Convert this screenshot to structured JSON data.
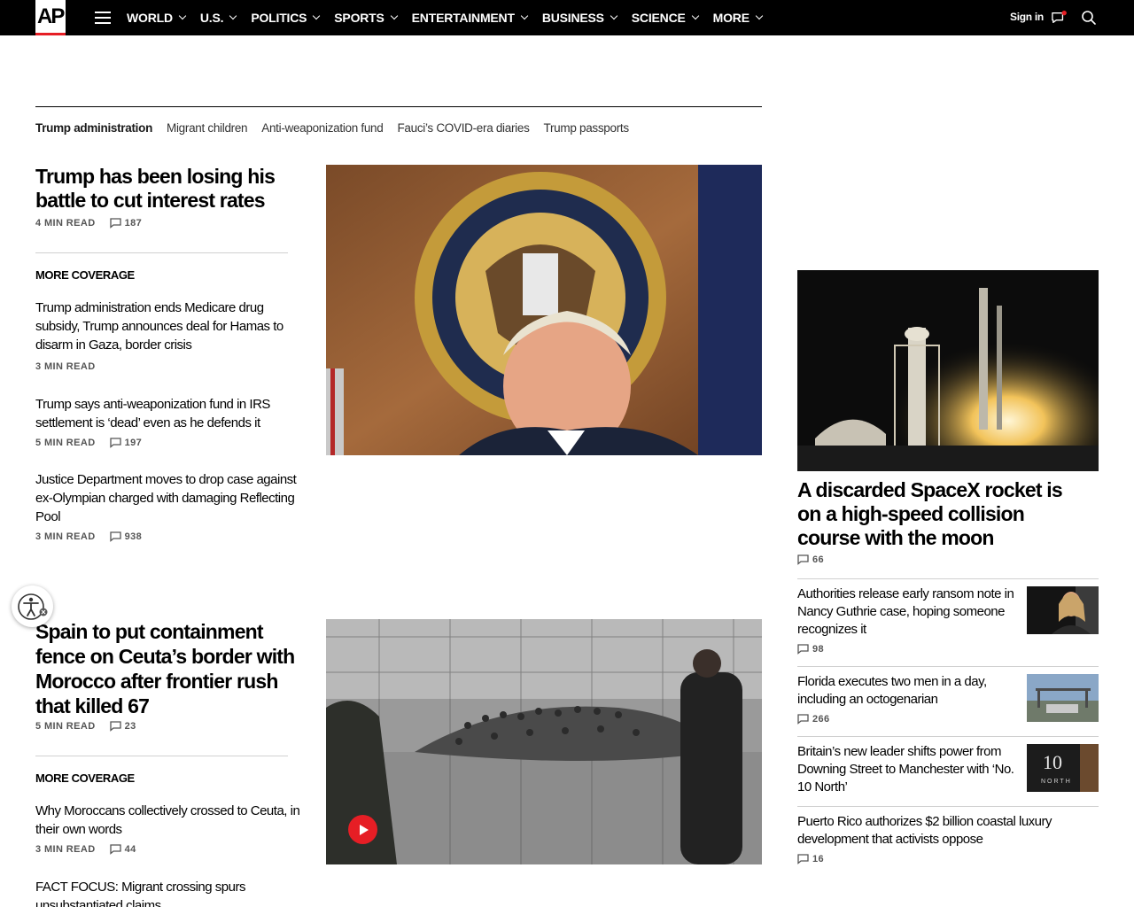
{
  "brand": {
    "logo_text": "AP",
    "accent_color": "#e61e25"
  },
  "nav": {
    "items": [
      {
        "label": "WORLD"
      },
      {
        "label": "U.S."
      },
      {
        "label": "POLITICS"
      },
      {
        "label": "SPORTS"
      },
      {
        "label": "ENTERTAINMENT"
      },
      {
        "label": "BUSINESS"
      },
      {
        "label": "SCIENCE"
      },
      {
        "label": "MORE"
      }
    ],
    "sign_in": "Sign in",
    "icons": [
      "menu-icon",
      "chevron-down-icon",
      "messages-icon",
      "search-icon"
    ]
  },
  "topics": [
    "Trump administration",
    "Migrant children",
    "Anti-weaponization fund",
    "Fauci’s COVID-era diaries",
    "Trump passports"
  ],
  "lead1": {
    "headline": "Trump has been losing his battle to cut interest rates",
    "read_time": "4 MIN READ",
    "comments": "187",
    "more_coverage_label": "MORE COVERAGE",
    "related": [
      {
        "headline": "Trump administration ends Medicare drug subsidy, Trump announces deal for Hamas to disarm in Gaza, border crisis",
        "read_time": "3 MIN READ",
        "comments": ""
      },
      {
        "headline": "Trump says anti-weaponization fund in IRS settlement is ‘dead’ even as he defends it",
        "read_time": "5 MIN READ",
        "comments": "197"
      },
      {
        "headline": "Justice Department moves to drop case against ex-Olympian charged with damaging Reflecting Pool",
        "read_time": "3 MIN READ",
        "comments": "938"
      }
    ]
  },
  "lead2": {
    "headline": "Spain to put containment fence on Ceuta’s border with Morocco after frontier rush that killed 67",
    "read_time": "5 MIN READ",
    "comments": "23",
    "more_coverage_label": "MORE COVERAGE",
    "related": [
      {
        "headline": "Why Moroccans collectively crossed to Ceuta, in their own words",
        "read_time": "3 MIN READ",
        "comments": "44"
      },
      {
        "headline": "FACT FOCUS: Migrant crossing spurs unsubstantiated claims",
        "read_time": "",
        "comments": ""
      }
    ]
  },
  "right": {
    "feature": {
      "headline": "A discarded SpaceX rocket is on a high-speed collision course with the moon",
      "comments": "66"
    },
    "items": [
      {
        "headline": "Authorities release early ransom note in Nancy Guthrie case, hoping someone recognizes it",
        "comments": "98"
      },
      {
        "headline": "Florida executes two men in a day, including an octogenarian",
        "comments": "266"
      },
      {
        "headline": "Britain’s new leader shifts power from Downing Street to Manchester with ‘No. 10 North’",
        "comments": ""
      },
      {
        "headline": "Puerto Rico authorizes $2 billion coastal luxury development that activists oppose",
        "comments": "16"
      }
    ],
    "thumb_sign_text": "10",
    "thumb_sign_sub": "NORTH"
  }
}
